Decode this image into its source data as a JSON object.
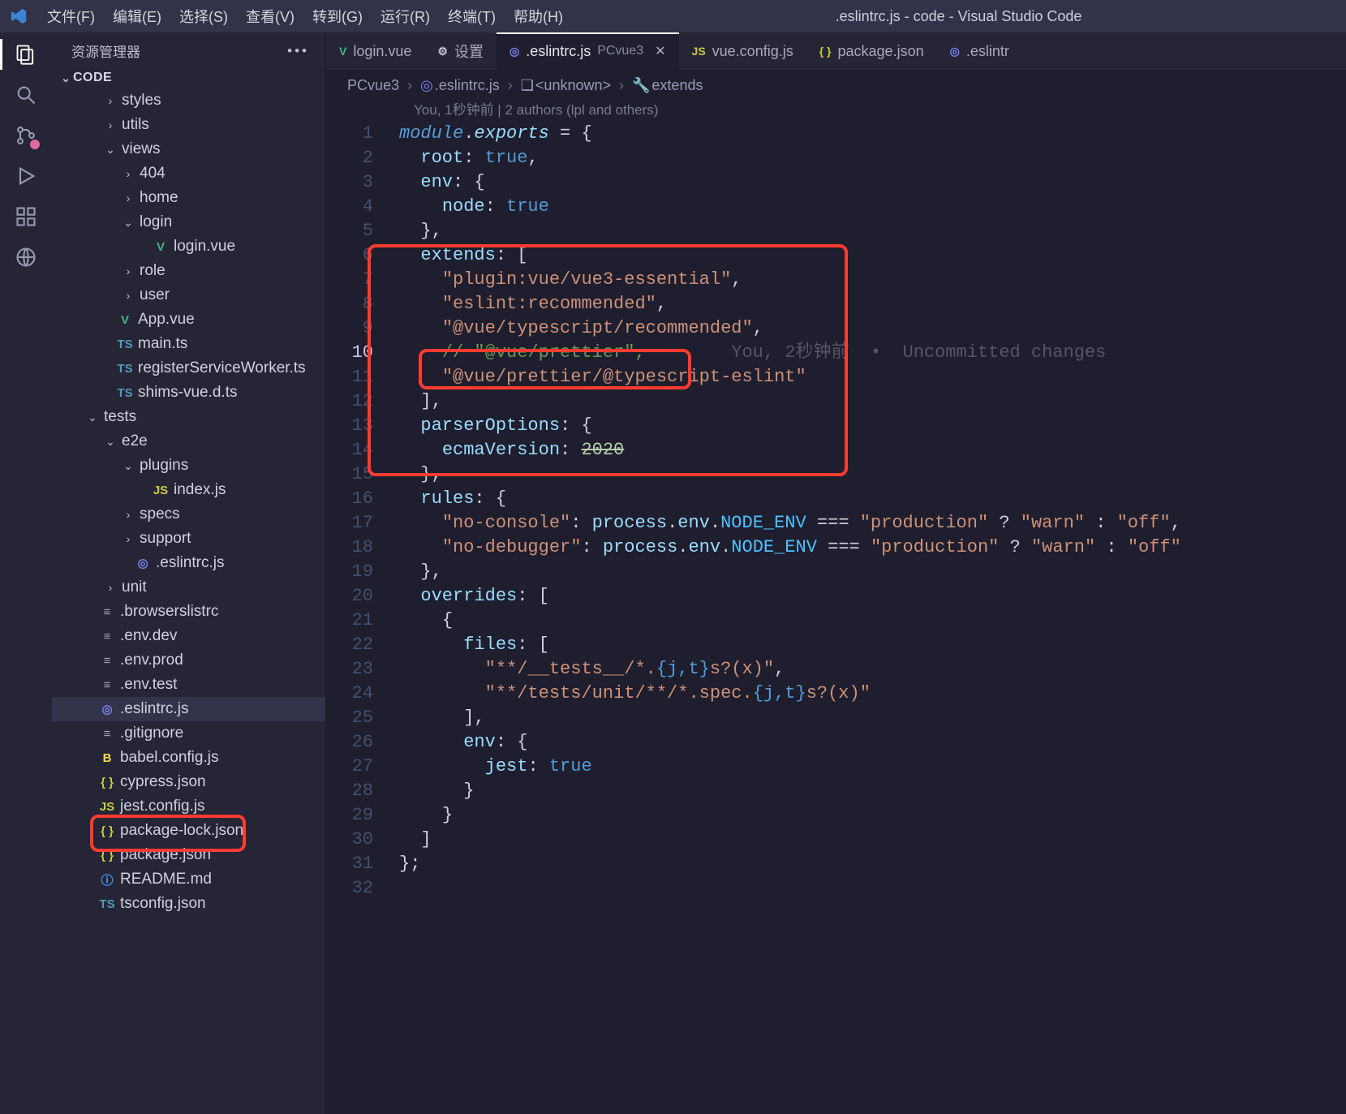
{
  "titlebar": {
    "menus": [
      "文件(F)",
      "编辑(E)",
      "选择(S)",
      "查看(V)",
      "转到(G)",
      "运行(R)",
      "终端(T)",
      "帮助(H)"
    ],
    "wintitle": ".eslintrc.js - code - Visual Studio Code"
  },
  "side": {
    "title": "资源管理器",
    "root": "CODE"
  },
  "fileTree": [
    {
      "depth": 2,
      "chev": "col",
      "icon": "",
      "label": "styles"
    },
    {
      "depth": 2,
      "chev": "col",
      "icon": "",
      "label": "utils"
    },
    {
      "depth": 2,
      "chev": "exp",
      "icon": "",
      "label": "views"
    },
    {
      "depth": 3,
      "chev": "col",
      "icon": "",
      "label": "404"
    },
    {
      "depth": 3,
      "chev": "col",
      "icon": "",
      "label": "home"
    },
    {
      "depth": 3,
      "chev": "exp",
      "icon": "",
      "label": "login"
    },
    {
      "depth": 4,
      "chev": "none",
      "icon": "vue",
      "iconText": "V",
      "label": "login.vue"
    },
    {
      "depth": 3,
      "chev": "col",
      "icon": "",
      "label": "role"
    },
    {
      "depth": 3,
      "chev": "col",
      "icon": "",
      "label": "user"
    },
    {
      "depth": 2,
      "chev": "none",
      "icon": "vue",
      "iconText": "V",
      "label": "App.vue"
    },
    {
      "depth": 2,
      "chev": "none",
      "icon": "ts",
      "iconText": "TS",
      "label": "main.ts"
    },
    {
      "depth": 2,
      "chev": "none",
      "icon": "ts",
      "iconText": "TS",
      "label": "registerServiceWorker.ts"
    },
    {
      "depth": 2,
      "chev": "none",
      "icon": "ts",
      "iconText": "TS",
      "label": "shims-vue.d.ts"
    },
    {
      "depth": 1,
      "chev": "exp",
      "icon": "",
      "label": "tests"
    },
    {
      "depth": 2,
      "chev": "exp",
      "icon": "",
      "label": "e2e"
    },
    {
      "depth": 3,
      "chev": "exp",
      "icon": "",
      "label": "plugins"
    },
    {
      "depth": 4,
      "chev": "none",
      "icon": "js",
      "iconText": "JS",
      "label": "index.js"
    },
    {
      "depth": 3,
      "chev": "col",
      "icon": "",
      "label": "specs"
    },
    {
      "depth": 3,
      "chev": "col",
      "icon": "",
      "label": "support"
    },
    {
      "depth": 3,
      "chev": "none",
      "icon": "eslint",
      "iconText": "◎",
      "label": ".eslintrc.js"
    },
    {
      "depth": 2,
      "chev": "col",
      "icon": "",
      "label": "unit"
    },
    {
      "depth": 1,
      "chev": "none",
      "icon": "gear",
      "iconText": "≡",
      "label": ".browserslistrc"
    },
    {
      "depth": 1,
      "chev": "none",
      "icon": "gear",
      "iconText": "≡",
      "label": ".env.dev"
    },
    {
      "depth": 1,
      "chev": "none",
      "icon": "gear",
      "iconText": "≡",
      "label": ".env.prod"
    },
    {
      "depth": 1,
      "chev": "none",
      "icon": "gear",
      "iconText": "≡",
      "label": ".env.test"
    },
    {
      "depth": 1,
      "chev": "none",
      "icon": "eslint",
      "iconText": "◎",
      "label": ".eslintrc.js",
      "selected": true
    },
    {
      "depth": 1,
      "chev": "none",
      "icon": "gear",
      "iconText": "≡",
      "label": ".gitignore"
    },
    {
      "depth": 1,
      "chev": "none",
      "icon": "babel",
      "iconText": "B",
      "label": "babel.config.js"
    },
    {
      "depth": 1,
      "chev": "none",
      "icon": "json",
      "iconText": "{ }",
      "label": "cypress.json"
    },
    {
      "depth": 1,
      "chev": "none",
      "icon": "js",
      "iconText": "JS",
      "label": "jest.config.js"
    },
    {
      "depth": 1,
      "chev": "none",
      "icon": "json",
      "iconText": "{ }",
      "label": "package-lock.json"
    },
    {
      "depth": 1,
      "chev": "none",
      "icon": "json",
      "iconText": "{ }",
      "label": "package.json"
    },
    {
      "depth": 1,
      "chev": "none",
      "icon": "info",
      "iconText": "ⓘ",
      "label": "README.md"
    },
    {
      "depth": 1,
      "chev": "none",
      "icon": "ts",
      "iconText": "TS",
      "label": "tsconfig.json"
    }
  ],
  "tabs": [
    {
      "icon": "vue",
      "iconText": "V",
      "label": "login.vue"
    },
    {
      "icon": "gear",
      "iconText": "⚙",
      "label": "设置"
    },
    {
      "icon": "eslint",
      "iconText": "◎",
      "label": ".eslintrc.js",
      "suffix": "PCvue3",
      "active": true,
      "close": true
    },
    {
      "icon": "js",
      "iconText": "JS",
      "label": "vue.config.js"
    },
    {
      "icon": "json",
      "iconText": "{ }",
      "label": "package.json"
    },
    {
      "icon": "eslint",
      "iconText": "◎",
      "label": ".eslintr"
    }
  ],
  "breadcrumbs": {
    "items": [
      {
        "text": "PCvue3"
      },
      {
        "icon": "eslint",
        "text": ".eslintrc.js"
      },
      {
        "icon": "cube",
        "text": "<unknown>"
      },
      {
        "icon": "wrench",
        "text": "extends"
      }
    ]
  },
  "gitLine": "You, 1秒钟前 | 2 authors (lpl and others)",
  "inlineBlame": "You, 2秒钟前  •  Uncommitted changes",
  "code": {
    "lines": [
      {
        "n": 1,
        "html": "<span class='mod'>module</span><span class='pun'>.</span><span class='modp'>exports</span> <span class='pun'>=</span> <span class='pun'>{</span>"
      },
      {
        "n": 2,
        "html": "  <span class='prop'>root</span><span class='pun'>:</span> <span class='bool'>true</span><span class='pun'>,</span>"
      },
      {
        "n": 3,
        "html": "  <span class='prop'>env</span><span class='pun'>:</span> <span class='pun'>{</span>"
      },
      {
        "n": 4,
        "html": "    <span class='prop'>node</span><span class='pun'>:</span> <span class='bool'>true</span>"
      },
      {
        "n": 5,
        "html": "  <span class='pun'>},</span>"
      },
      {
        "n": 6,
        "html": "  <span class='prop'>extends</span><span class='pun'>:</span> <span class='pun'>[</span>"
      },
      {
        "n": 7,
        "html": "    <span class='str'>\"plugin:vue/vue3-essential\"</span><span class='pun'>,</span>"
      },
      {
        "n": 8,
        "html": "    <span class='str'>\"eslint:recommended\"</span><span class='pun'>,</span>"
      },
      {
        "n": 9,
        "html": "    <span class='str'>\"@vue/typescript/recommended\"</span><span class='pun'>,</span>"
      },
      {
        "n": 10,
        "html": "    <span class='cmt'>// \"@vue/prettier\",</span>",
        "cur": true,
        "blame": true
      },
      {
        "n": 11,
        "html": "    <span class='str'>\"@vue/prettier/@typescript-eslint\"</span>"
      },
      {
        "n": 12,
        "html": "  <span class='pun'>],</span>"
      },
      {
        "n": 13,
        "html": "  <span class='prop'>parserOptions</span><span class='pun'>:</span> <span class='pun'>{</span>"
      },
      {
        "n": 14,
        "html": "    <span class='prop'>ecmaVersion</span><span class='pun'>:</span> <span class='num strike'>2020</span>"
      },
      {
        "n": 15,
        "html": "  <span class='pun'>},</span>"
      },
      {
        "n": 16,
        "html": "  <span class='prop'>rules</span><span class='pun'>:</span> <span class='pun'>{</span>"
      },
      {
        "n": 17,
        "html": "    <span class='str'>\"no-console\"</span><span class='pun'>:</span> <span class='prop'>process</span><span class='pun'>.</span><span class='prop'>env</span><span class='pun'>.</span><span class='type2' style='color:#4FC1FF'>NODE_ENV</span> <span class='pun'>===</span> <span class='str'>\"production\"</span> <span class='pun'>?</span> <span class='str'>\"warn\"</span> <span class='pun'>:</span> <span class='str'>\"off\"</span><span class='pun'>,</span>"
      },
      {
        "n": 18,
        "html": "    <span class='str'>\"no-debugger\"</span><span class='pun'>:</span> <span class='prop'>process</span><span class='pun'>.</span><span class='prop'>env</span><span class='pun'>.</span><span style='color:#4FC1FF'>NODE_ENV</span> <span class='pun'>===</span> <span class='str'>\"production\"</span> <span class='pun'>?</span> <span class='str'>\"warn\"</span> <span class='pun'>:</span> <span class='str'>\"off\"</span>"
      },
      {
        "n": 19,
        "html": "  <span class='pun'>},</span>"
      },
      {
        "n": 20,
        "html": "  <span class='prop'>overrides</span><span class='pun'>:</span> <span class='pun'>[</span>"
      },
      {
        "n": 21,
        "html": "    <span class='pun'>{</span>"
      },
      {
        "n": 22,
        "html": "      <span class='prop'>files</span><span class='pun'>:</span> <span class='pun'>[</span>"
      },
      {
        "n": 23,
        "html": "        <span class='str'>\"**/__tests__/*.</span><span class='bool'>{j,t}</span><span class='str'>s?(x)\"</span><span class='pun'>,</span>"
      },
      {
        "n": 24,
        "html": "        <span class='str'>\"**/tests/unit/**/*.spec.</span><span class='bool'>{j,t}</span><span class='str'>s?(x)\"</span>"
      },
      {
        "n": 25,
        "html": "      <span class='pun'>],</span>"
      },
      {
        "n": 26,
        "html": "      <span class='prop'>env</span><span class='pun'>:</span> <span class='pun'>{</span>"
      },
      {
        "n": 27,
        "html": "        <span class='prop'>jest</span><span class='pun'>:</span> <span class='bool'>true</span>"
      },
      {
        "n": 28,
        "html": "      <span class='pun'>}</span>"
      },
      {
        "n": 29,
        "html": "    <span class='pun'>}</span>"
      },
      {
        "n": 30,
        "html": "  <span class='pun'>]</span>"
      },
      {
        "n": 31,
        "html": "<span class='pun'>};</span>"
      },
      {
        "n": 32,
        "html": ""
      }
    ]
  }
}
